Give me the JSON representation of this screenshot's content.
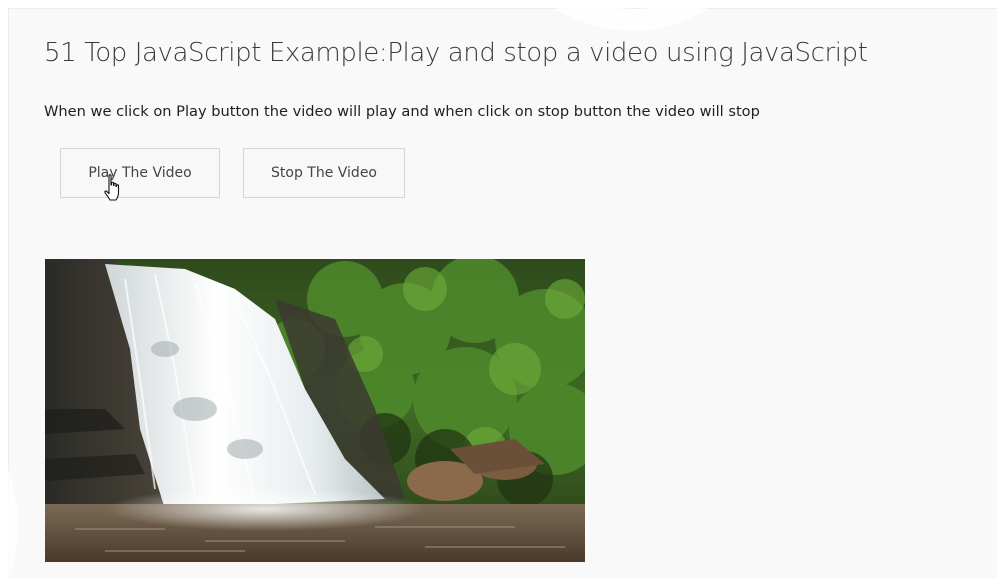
{
  "page": {
    "title": "51 Top JavaScript Example:Play and stop a video using JavaScript",
    "description": "When we click on Play button the video will play and when click on stop button the video will stop"
  },
  "controls": {
    "play_label": "Play The Video",
    "stop_label": "Stop The Video"
  },
  "video": {
    "scene": "waterfall",
    "state": "stopped"
  },
  "icons": {
    "cursor": "hand-pointer-icon"
  },
  "colors": {
    "panel_background": "#f9f9f9",
    "button_border": "#d4d4d4",
    "title_text": "#3a3a3a"
  }
}
